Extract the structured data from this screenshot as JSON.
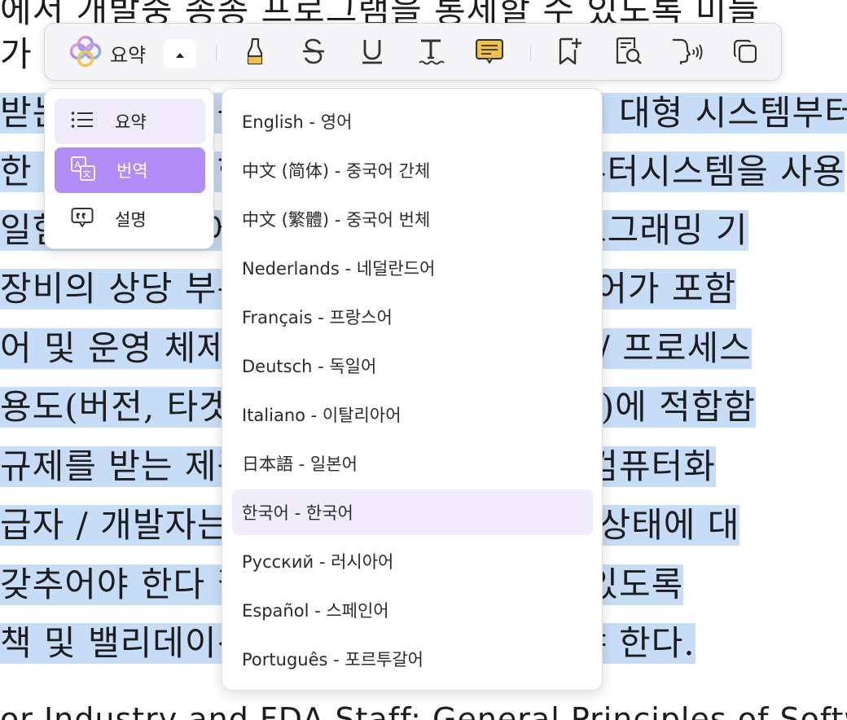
{
  "document": {
    "lines": [
      {
        "text": "에서 개발중 종종 프로그램을 통제할 수 있도록 미들",
        "highlighted": false
      },
      {
        "text": "가",
        "highlighted": false
      },
      {
        "text": "받는 제품의 기능이 작은 임베디드 시스템 대형 시스템부터",
        "highlighted": true
      },
      {
        "text": "한 시스템을 위한 소프트웨어와 함께 컴퓨터시스템을 사용",
        "highlighted": true
      },
      {
        "text": "일험 프로세스에 대한 이러한 범위의 프로그래밍 기",
        "highlighted": true
      },
      {
        "text": "장비의 상당 부분에는 품질관리 소프트웨어가 포함",
        "highlighted": true
      },
      {
        "text": "어 및 운영 체제 다양한 소프트웨어 검증 / 프로세스",
        "highlighted": true
      },
      {
        "text": "용도(버전, 타겟 환경 등의 세부사항 포함)에 적합함",
        "highlighted": true
      },
      {
        "text": "규제를 받는 제품 생산에 사용되는 모든 컴퓨터화",
        "highlighted": true
      },
      {
        "text": "급자 / 개발자는 시스템 요구사항과 확인 상태에 대",
        "highlighted": true
      },
      {
        "text": "갖추어야 한다 필요한 문서를 제공할 수 있도록",
        "highlighted": true
      },
      {
        "text": "책 및 밸리데이션 절차를 적절히 갖추어야 한다.",
        "highlighted": true
      },
      {
        "text": "or Industry and FDA Staff: General Principles of Softw",
        "highlighted": false
      }
    ]
  },
  "toolbar": {
    "ai_label": "요약",
    "ai_icon": "ai-flower-logo",
    "toggle_icon": "caret-up-icon",
    "tools": [
      {
        "name": "highlighter-icon"
      },
      {
        "name": "strikethrough-icon"
      },
      {
        "name": "underline-icon"
      },
      {
        "name": "squiggly-text-icon"
      },
      {
        "name": "comment-icon"
      },
      {
        "name": "bookmark-add-icon"
      },
      {
        "name": "search-document-icon"
      },
      {
        "name": "read-aloud-icon"
      },
      {
        "name": "copy-icon"
      }
    ]
  },
  "ai_menu": {
    "items": [
      {
        "label": "요약",
        "icon": "list-icon",
        "state": "hover"
      },
      {
        "label": "번역",
        "icon": "translate-icon",
        "state": "active"
      },
      {
        "label": "설명",
        "icon": "explain-icon",
        "state": "normal"
      }
    ]
  },
  "language_menu": {
    "selected": "한국어 - 한국어",
    "items": [
      "English - 영어",
      "中文 (简体) - 중국어 간체",
      "中文 (繁體) - 중국어 번체",
      "Nederlands - 네덜란드어",
      "Français - 프랑스어",
      "Deutsch - 독일어",
      "Italiano - 이탈리아어",
      "日本語 - 일본어",
      "한국어 - 한국어",
      "Русский - 러시아어",
      "Español - 스페인어",
      "Português - 포르투갈어"
    ]
  },
  "colors": {
    "highlight": "#c7dcf6",
    "accent": "#b18cf7",
    "accent_soft": "#efebfb",
    "selected_lang_bg": "#f1ecfb"
  }
}
